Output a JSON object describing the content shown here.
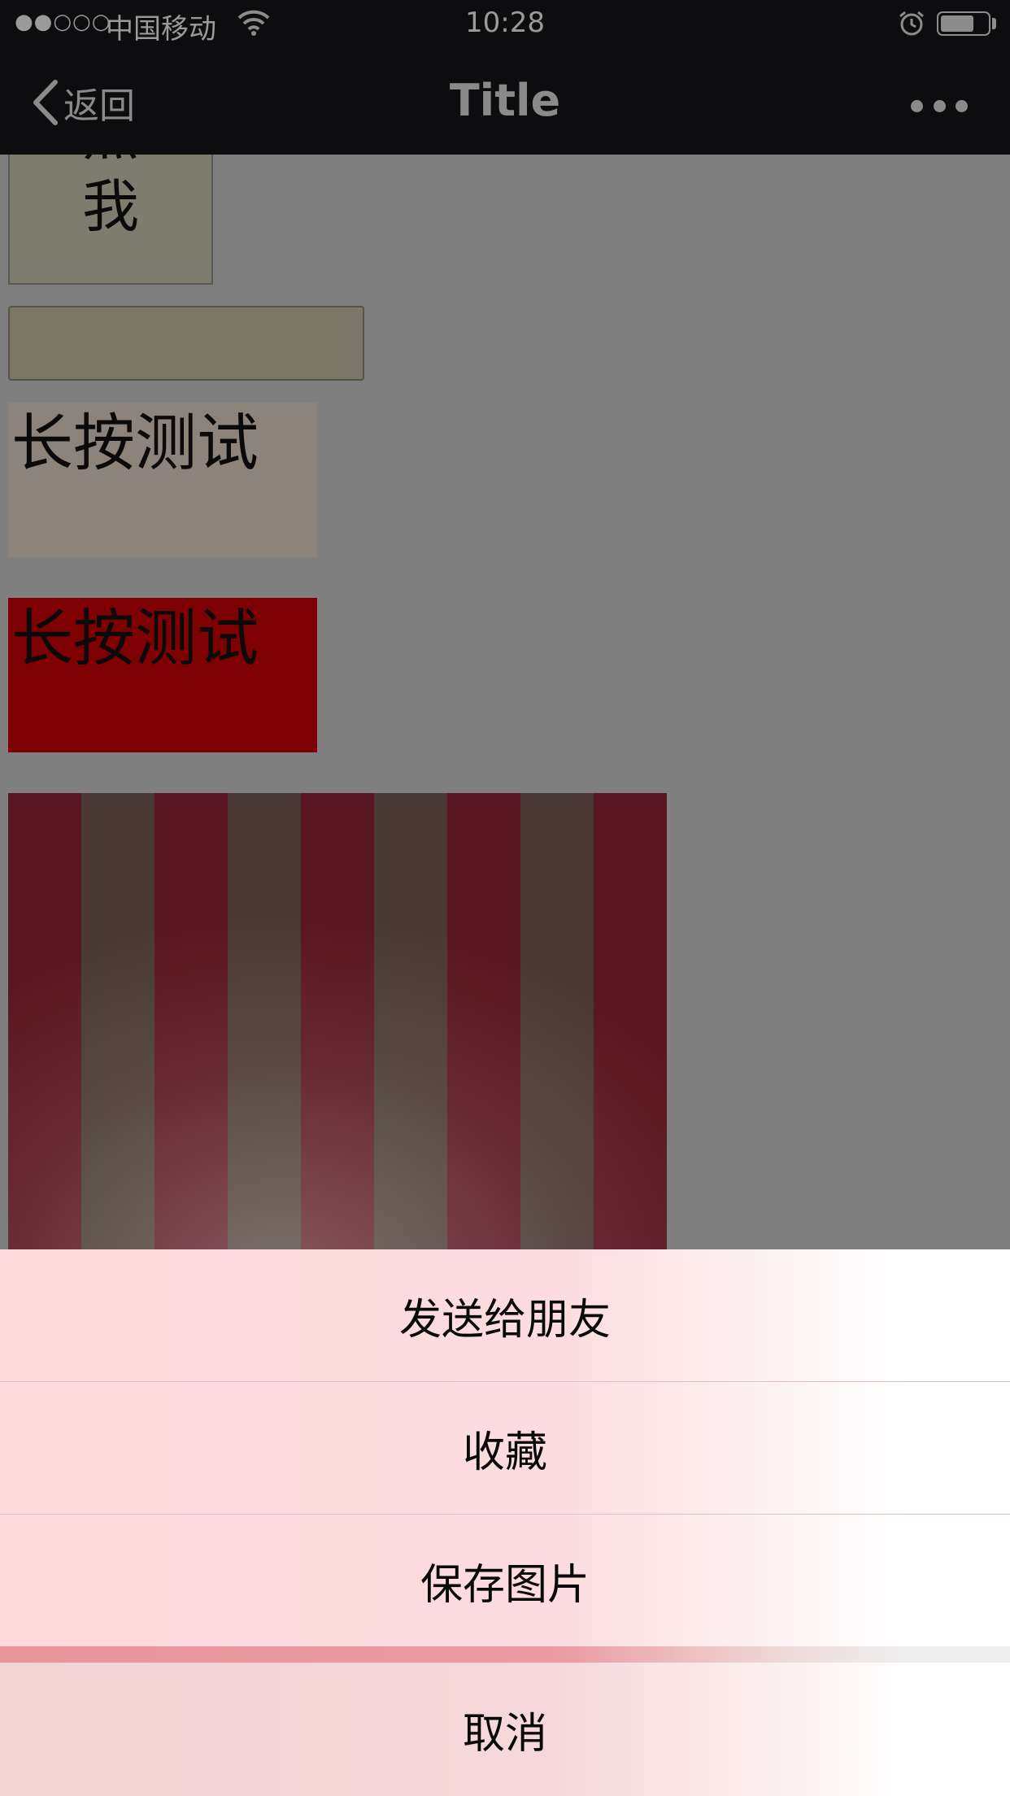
{
  "status_bar": {
    "signal": "●●○○○",
    "carrier": "中国移动",
    "time": "10:28",
    "battery_level": 0.72
  },
  "nav": {
    "back_label": "返回",
    "title": "Title"
  },
  "content": {
    "click_button": {
      "line1": "点",
      "line2": "我"
    },
    "input_value": "",
    "long_press_1": "长按测试",
    "long_press_2": "长按测试",
    "stripe_colors": [
      "#5a1620",
      "#4a3a33"
    ]
  },
  "action_sheet": {
    "items": [
      "发送给朋友",
      "收藏",
      "保存图片"
    ],
    "cancel": "取消"
  },
  "colors": {
    "bar_bg": "#0d0d0f",
    "overlay_gray": "#7f7f7f",
    "red_box": "#7f0002",
    "sheet_pink": "#fdd9dc"
  }
}
